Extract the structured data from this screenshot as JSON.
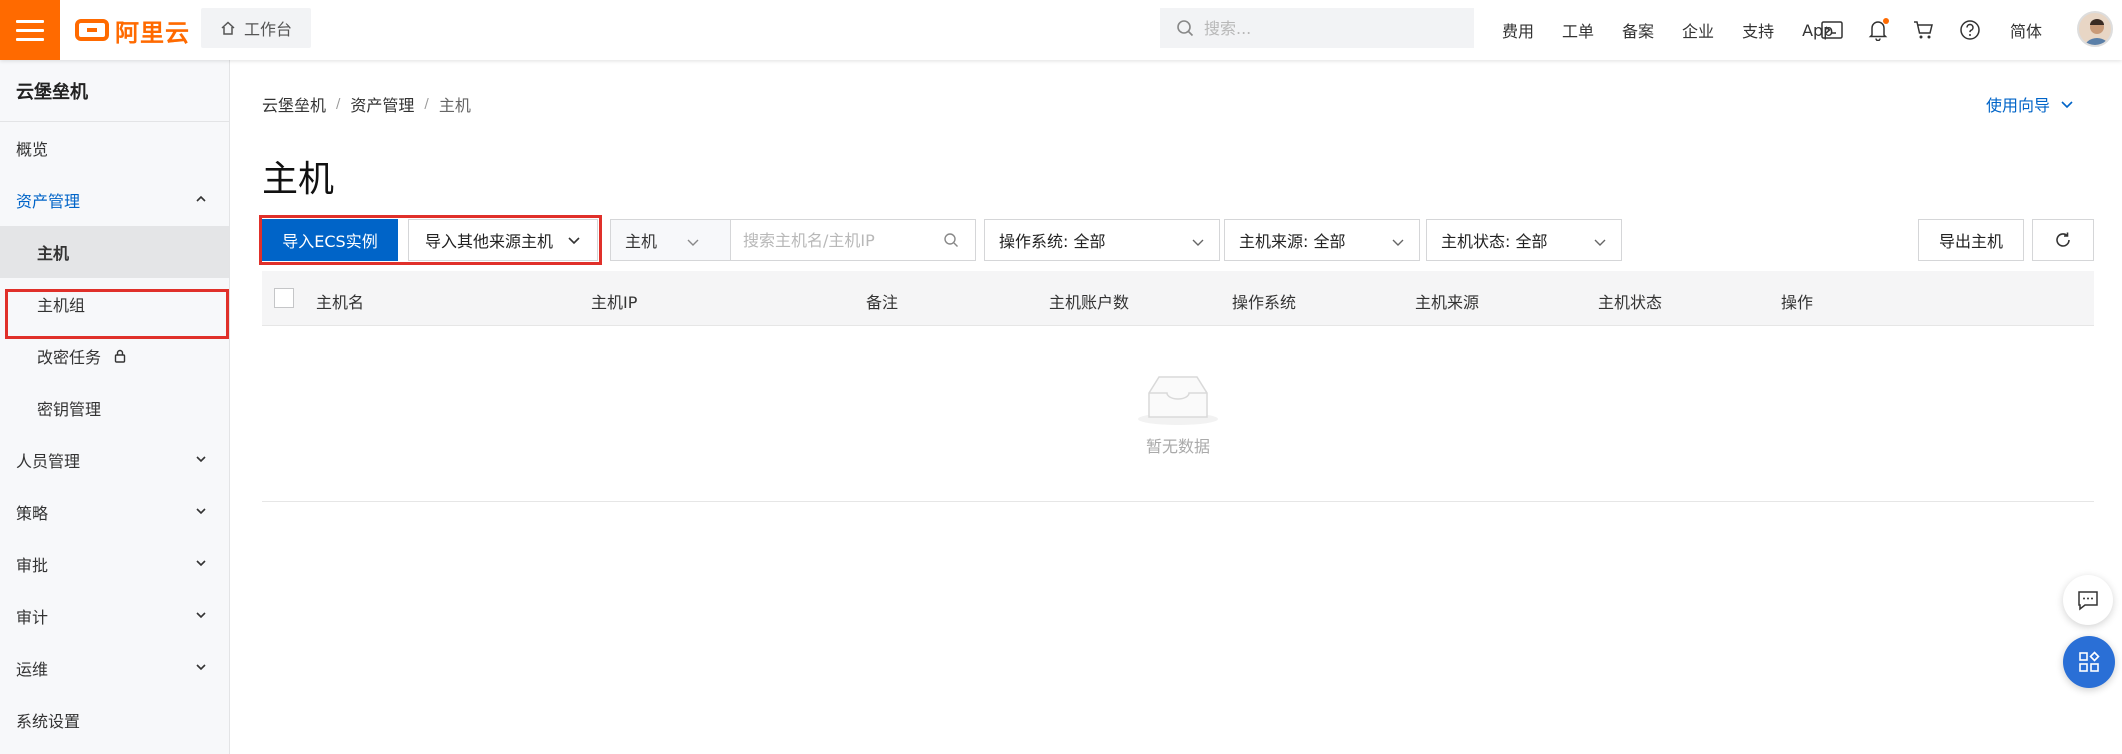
{
  "topbar": {
    "logo_text": "阿里云",
    "workbench_label": "工作台",
    "search_placeholder": "搜索...",
    "nav_links": [
      "费用",
      "工单",
      "备案",
      "企业",
      "支持",
      "App"
    ],
    "lang_label": "简体",
    "accent": "#ff6a00"
  },
  "sidebar": {
    "title": "云堡垒机",
    "items": [
      {
        "label": "概览"
      },
      {
        "label": "资产管理"
      },
      {
        "label": "主机"
      },
      {
        "label": "主机组"
      },
      {
        "label": "改密任务"
      },
      {
        "label": "密钥管理"
      },
      {
        "label": "人员管理"
      },
      {
        "label": "策略"
      },
      {
        "label": "审批"
      },
      {
        "label": "审计"
      },
      {
        "label": "运维"
      },
      {
        "label": "系统设置"
      }
    ]
  },
  "main": {
    "breadcrumb": [
      "云堡垒机",
      "资产管理",
      "主机"
    ],
    "guide_label": "使用向导",
    "page_title": "主机",
    "toolbar": {
      "import_ecs_label": "导入ECS实例",
      "import_other_label": "导入其他来源主机",
      "search_type": "主机",
      "search_placeholder": "搜索主机名/主机IP",
      "filter_os": "操作系统: 全部",
      "filter_source": "主机来源: 全部",
      "filter_status": "主机状态: 全部",
      "export_label": "导出主机"
    },
    "table": {
      "columns": [
        "主机名",
        "主机IP",
        "备注",
        "主机账户数",
        "操作系统",
        "主机来源",
        "主机状态",
        "操作"
      ],
      "empty_text": "暂无数据"
    }
  },
  "colors": {
    "primary": "#0064c8",
    "highlight": "#e0302a"
  }
}
